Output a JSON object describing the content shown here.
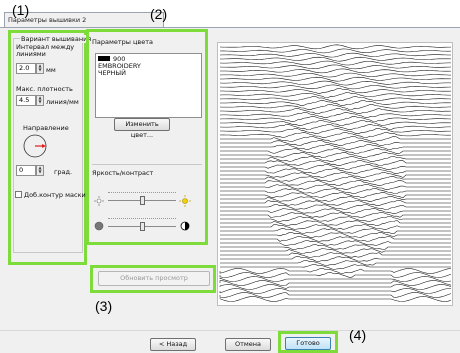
{
  "tab": {
    "label": "Параметры вышивки 2"
  },
  "callouts": {
    "c1": "(1)",
    "c2": "(2)",
    "c3": "(3)",
    "c4": "(4)"
  },
  "left_panel": {
    "group_title": "Вариант вышивания",
    "interval_label": "Интервал между линиями",
    "interval_value": "2.0",
    "interval_unit": "мм",
    "density_label": "Макс. плотность",
    "density_value": "4.5",
    "density_unit": "линия/мм",
    "direction_label": "Направление",
    "angle_value": "0",
    "angle_unit": "град.",
    "outline_checkbox_label": "Доб.контур маски",
    "outline_checked": false
  },
  "color_panel": {
    "title": "Параметры цвета",
    "color_code": "900",
    "color_brand": "EMBROIDERY",
    "color_name": "ЧЕРНЫЙ",
    "swatch_color": "#000000",
    "change_color_button": "Изменить цвет...",
    "brightness_contrast_label": "Яркость/контраст",
    "brightness_level": 0.5,
    "contrast_level": 0.5
  },
  "refresh_button": "Обновить просмотр",
  "footer": {
    "back_button": "< Назад",
    "cancel_button": "Отмена",
    "done_button": "Готово"
  },
  "colors": {
    "highlight": "#7ddc3a",
    "window": "#f0f0f0",
    "direction_arrow": "#e02020"
  }
}
